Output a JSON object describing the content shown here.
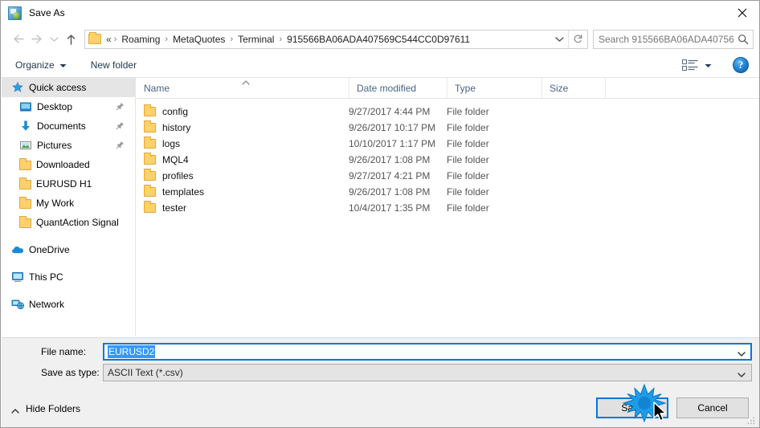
{
  "window": {
    "title": "Save As",
    "title_icon": "save-as-app-icon",
    "close_icon": "close-icon"
  },
  "nav": {
    "back_icon": "arrow-left-icon",
    "forward_icon": "arrow-right-icon",
    "recent_icon": "chevron-down-icon",
    "up_icon": "arrow-up-icon",
    "address": {
      "folder_icon": "folder-icon",
      "prefix": "«",
      "crumbs": [
        "Roaming",
        "MetaQuotes",
        "Terminal",
        "915566BA06ADA407569C544CC0D97611"
      ],
      "separator": "›",
      "dropdown_icon": "chevron-down-icon",
      "refresh_icon": "refresh-icon"
    },
    "search": {
      "placeholder": "Search 915566BA06ADA40756...",
      "icon": "search-icon"
    }
  },
  "toolbar": {
    "organize_label": "Organize",
    "organize_caret": "caret-down-icon",
    "new_folder_label": "New folder",
    "view_icon": "list-view-icon",
    "view_caret": "caret-down-icon",
    "help_label": "?",
    "help_icon": "help-icon"
  },
  "sidebar": {
    "items": [
      {
        "label": "Quick access",
        "icon": "pin-star-icon",
        "selected": true,
        "indent": "root",
        "pinned": false
      },
      {
        "label": "Desktop",
        "icon": "desktop-icon",
        "selected": false,
        "indent": "0",
        "pinned": true
      },
      {
        "label": "Documents",
        "icon": "documents-icon",
        "selected": false,
        "indent": "0",
        "pinned": true
      },
      {
        "label": "Pictures",
        "icon": "pictures-icon",
        "selected": false,
        "indent": "0",
        "pinned": true
      },
      {
        "label": "Downloaded",
        "icon": "folder-icon",
        "selected": false,
        "indent": "0",
        "pinned": false
      },
      {
        "label": "EURUSD H1",
        "icon": "folder-icon",
        "selected": false,
        "indent": "0",
        "pinned": false
      },
      {
        "label": "My Work",
        "icon": "folder-icon",
        "selected": false,
        "indent": "0",
        "pinned": false
      },
      {
        "label": "QuantAction Signal",
        "icon": "folder-icon",
        "selected": false,
        "indent": "0",
        "pinned": false
      },
      {
        "label": "OneDrive",
        "icon": "onedrive-icon",
        "selected": false,
        "indent": "root",
        "pinned": false,
        "gap_before": true
      },
      {
        "label": "This PC",
        "icon": "this-pc-icon",
        "selected": false,
        "indent": "root",
        "pinned": false,
        "gap_before": true
      },
      {
        "label": "Network",
        "icon": "network-icon",
        "selected": false,
        "indent": "root",
        "pinned": false,
        "gap_before": true
      }
    ]
  },
  "filelist": {
    "columns": [
      "Name",
      "Date modified",
      "Type",
      "Size"
    ],
    "sort_column": "Name",
    "sort_direction": "ascending",
    "sort_icon": "caret-up-icon",
    "rows": [
      {
        "name": "config",
        "date": "9/27/2017 4:44 PM",
        "type": "File folder",
        "size": "",
        "icon": "folder-icon"
      },
      {
        "name": "history",
        "date": "9/26/2017 10:17 PM",
        "type": "File folder",
        "size": "",
        "icon": "folder-icon"
      },
      {
        "name": "logs",
        "date": "10/10/2017 1:17 PM",
        "type": "File folder",
        "size": "",
        "icon": "folder-icon"
      },
      {
        "name": "MQL4",
        "date": "9/26/2017 1:08 PM",
        "type": "File folder",
        "size": "",
        "icon": "folder-icon"
      },
      {
        "name": "profiles",
        "date": "9/27/2017 4:21 PM",
        "type": "File folder",
        "size": "",
        "icon": "folder-icon"
      },
      {
        "name": "templates",
        "date": "9/26/2017 1:08 PM",
        "type": "File folder",
        "size": "",
        "icon": "folder-icon"
      },
      {
        "name": "tester",
        "date": "10/4/2017 1:35 PM",
        "type": "File folder",
        "size": "",
        "icon": "folder-icon"
      }
    ]
  },
  "form": {
    "filename_label": "File name:",
    "filename_value": "EURUSD2",
    "filename_selected": true,
    "filename_chevron": "chevron-down-icon",
    "savetype_label": "Save as type:",
    "savetype_value": "ASCII Text (*.csv)",
    "savetype_chevron": "chevron-down-icon"
  },
  "footer": {
    "hide_folders_label": "Hide Folders",
    "hide_folders_caret": "caret-up-icon",
    "save_label": "Save",
    "cancel_label": "Cancel",
    "resize_grip": "resize-grip-icon"
  },
  "colors": {
    "accent": "#0078d7",
    "selection": "#3399ff",
    "folder": "#ffd16b",
    "header_text": "#4a6484",
    "panel": "#f0f0f0"
  }
}
